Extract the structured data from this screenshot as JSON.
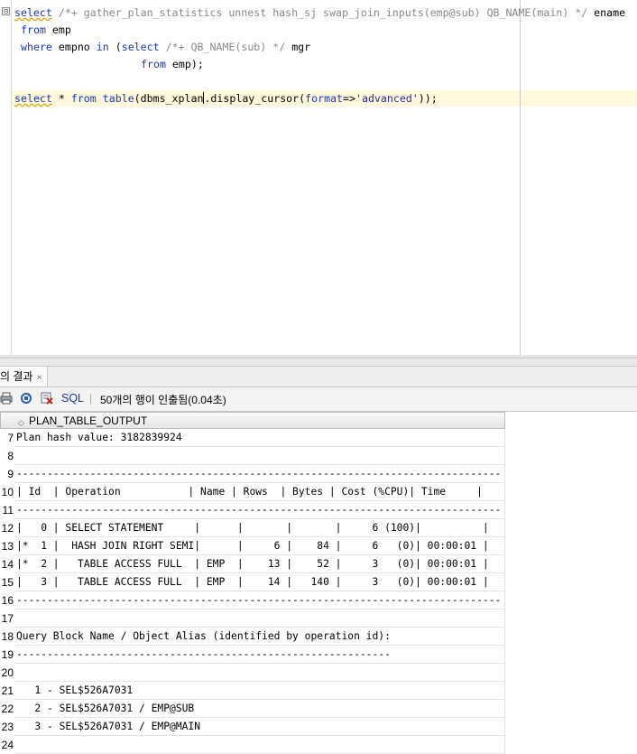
{
  "editor": {
    "lines": [
      {
        "kw": "select",
        "rest_comment": " /*+ gather_plan_statistics unnest hash_sj swap_join_inputs(emp@sub) QB_NAME(main) */",
        "rest": " ename"
      },
      {
        "kw": "from",
        "rest": " emp"
      },
      {
        "kw": "where",
        "mid": " empno ",
        "kw2": "in",
        "mid2": " (",
        "kw3": "select",
        "comment": " /*+ QB_NAME(sub) */",
        "rest": " mgr"
      },
      {
        "kw": "from",
        "rest": " emp);"
      },
      {
        "kw": "select",
        "mid": " * ",
        "kw2": "from",
        "mid2": " ",
        "kw3": "table",
        "paren": "(dbms_xplan",
        "after_caret": ".display_cursor(",
        "kw4": "format",
        "arrow": "=>",
        "str": "'advanced'",
        "end": "));"
      }
    ],
    "fold_symbol": "⊟"
  },
  "results": {
    "tab_label": "의 결과",
    "tab_close": "×",
    "toolbar": {
      "sql_label": "SQL",
      "separator": "|",
      "status": "50개의 행이 인출됨(0.04초)"
    },
    "column_header": "PLAN_TABLE_OUTPUT",
    "rows": [
      {
        "n": "7",
        "text": "Plan hash value: 3182839924"
      },
      {
        "n": "8",
        "text": ""
      },
      {
        "n": "9",
        "text": "-------------------------------------------------------------------------------"
      },
      {
        "n": "10",
        "text": "| Id  | Operation           | Name | Rows  | Bytes | Cost (%CPU)| Time     |"
      },
      {
        "n": "11",
        "text": "-------------------------------------------------------------------------------"
      },
      {
        "n": "12",
        "text": "|   0 | SELECT STATEMENT     |      |       |       |     6 (100)|          |"
      },
      {
        "n": "13",
        "text": "|*  1 |  HASH JOIN RIGHT SEMI|      |     6 |    84 |     6   (0)| 00:00:01 |"
      },
      {
        "n": "14",
        "text": "|*  2 |   TABLE ACCESS FULL  | EMP  |    13 |    52 |     3   (0)| 00:00:01 |"
      },
      {
        "n": "15",
        "text": "|   3 |   TABLE ACCESS FULL  | EMP  |    14 |   140 |     3   (0)| 00:00:01 |"
      },
      {
        "n": "16",
        "text": "-------------------------------------------------------------------------------"
      },
      {
        "n": "17",
        "text": ""
      },
      {
        "n": "18",
        "text": "Query Block Name / Object Alias (identified by operation id):"
      },
      {
        "n": "19",
        "text": "-------------------------------------------------------------"
      },
      {
        "n": "20",
        "text": ""
      },
      {
        "n": "21",
        "text": "   1 - SEL$526A7031"
      },
      {
        "n": "22",
        "text": "   2 - SEL$526A7031 / EMP@SUB"
      },
      {
        "n": "23",
        "text": "   3 - SEL$526A7031 / EMP@MAIN"
      },
      {
        "n": "24",
        "text": ""
      }
    ]
  }
}
